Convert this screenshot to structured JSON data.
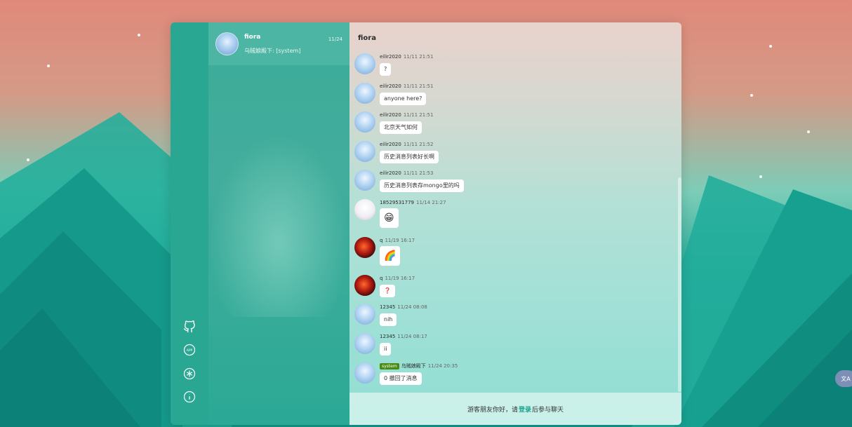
{
  "conversation_list": [
    {
      "name": "fiora",
      "last_message": "乌贼娘殿下: [system]",
      "time": "11/24"
    }
  ],
  "chat": {
    "title": "fiora",
    "messages": [
      {
        "nick": "eilir2020",
        "time": "11/11 21:51",
        "text": "?",
        "avatar": "blue"
      },
      {
        "nick": "eilir2020",
        "time": "11/11 21:51",
        "text": "anyone here?",
        "avatar": "blue"
      },
      {
        "nick": "eilir2020",
        "time": "11/11 21:51",
        "text": "北京天气如何",
        "avatar": "blue"
      },
      {
        "nick": "eilir2020",
        "time": "11/11 21:52",
        "text": "历史消息列表好长啊",
        "avatar": "blue"
      },
      {
        "nick": "eilir2020",
        "time": "11/11 21:53",
        "text": "历史消息列表存mongo里的吗",
        "avatar": "blue"
      },
      {
        "nick": "18529531779",
        "time": "11/14 21:27",
        "text": "😁",
        "avatar": "white"
      },
      {
        "nick": "q",
        "time": "11/19 16:17",
        "text": "🌈",
        "avatar": "red"
      },
      {
        "nick": "q",
        "time": "11/19 16:17",
        "text": "❓",
        "avatar": "red"
      },
      {
        "nick": "12345",
        "time": "11/24 08:08",
        "text": "nih",
        "avatar": "blue"
      },
      {
        "nick": "12345",
        "time": "11/24 08:17",
        "text": "ii",
        "avatar": "blue"
      },
      {
        "nick": "乌贼娘殿下",
        "time": "11/24 20:35",
        "text": "0 撤回了消息",
        "avatar": "blue",
        "badge": "system"
      }
    ]
  },
  "footer": {
    "prefix": "游客朋友你好，请",
    "login": "登录",
    "suffix": "后参与聊天"
  },
  "sidebar": {
    "icons": [
      "github-icon",
      "app-icon",
      "settings-icon",
      "info-icon"
    ],
    "app_label": "APP"
  },
  "translate_button": {
    "label": "文A"
  }
}
